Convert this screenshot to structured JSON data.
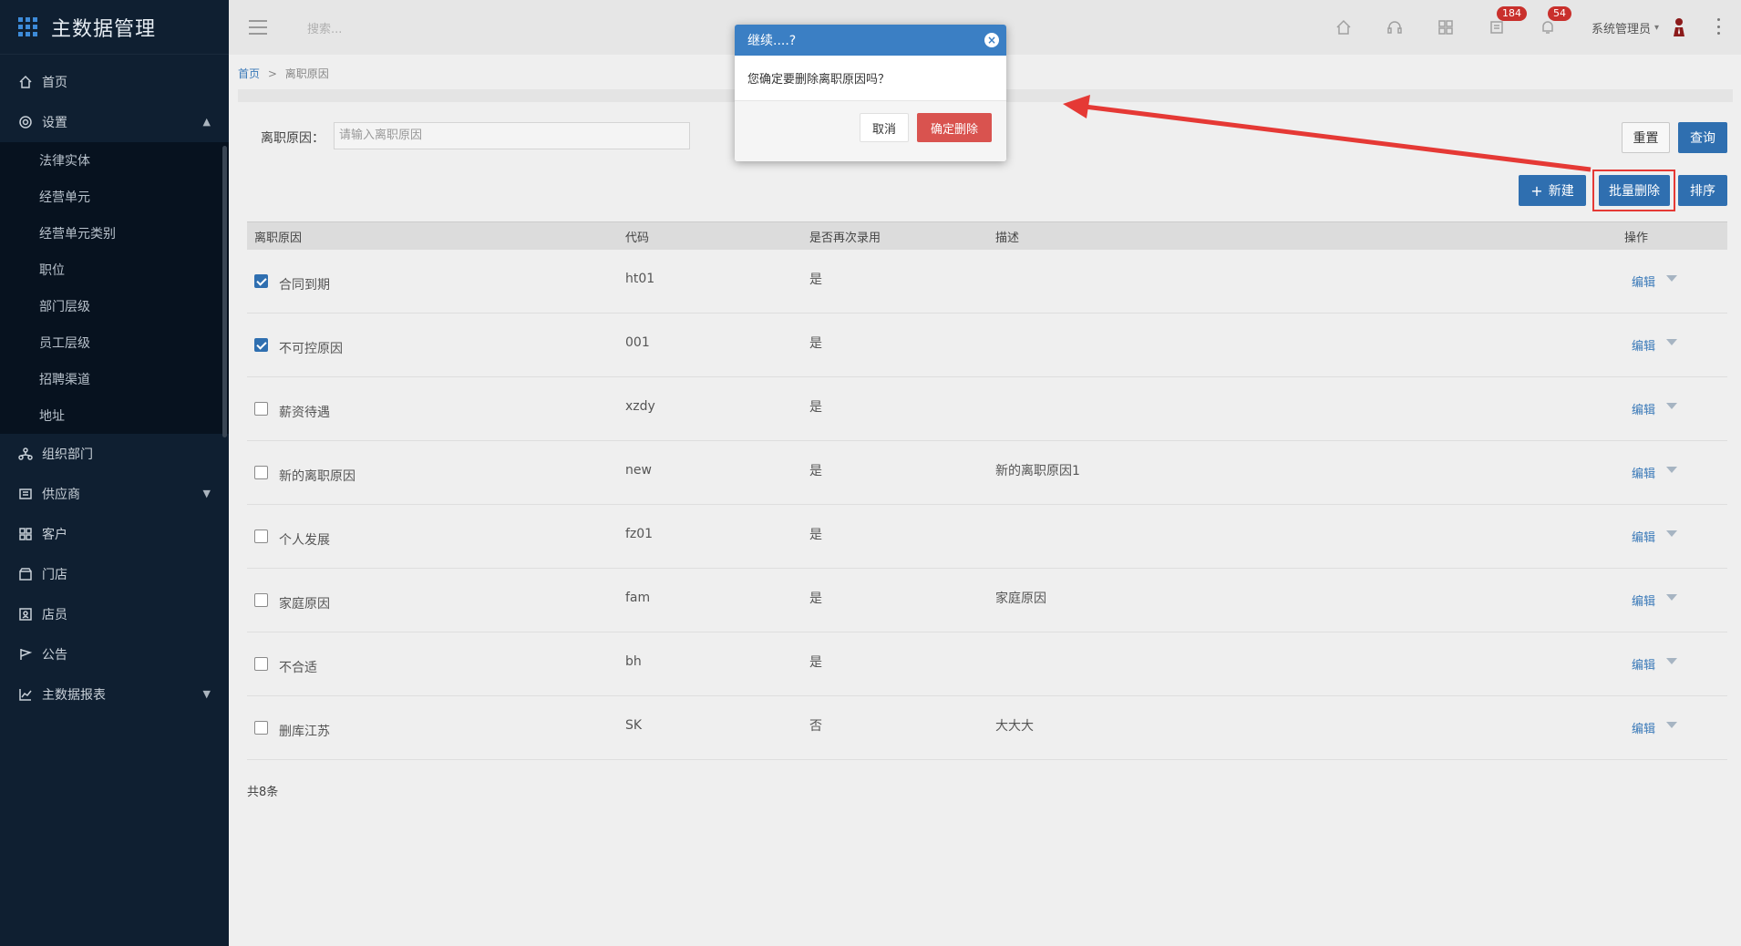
{
  "app": {
    "title": "主数据管理"
  },
  "header": {
    "search_placeholder": "搜索...",
    "badge_messages": "184",
    "badge_notifications": "54",
    "user_name": "系统管理员"
  },
  "sidebar": {
    "items": [
      {
        "label": "首页",
        "icon": "home-icon"
      },
      {
        "label": "设置",
        "icon": "gear-icon"
      },
      {
        "label": "组织部门",
        "icon": "org-icon"
      },
      {
        "label": "供应商",
        "icon": "supplier-icon"
      },
      {
        "label": "客户",
        "icon": "customer-icon"
      },
      {
        "label": "门店",
        "icon": "store-icon"
      },
      {
        "label": "店员",
        "icon": "staff-icon"
      },
      {
        "label": "公告",
        "icon": "announce-icon"
      },
      {
        "label": "主数据报表",
        "icon": "chart-icon"
      }
    ],
    "settings_sub": [
      "法律实体",
      "经营单元",
      "经营单元类别",
      "职位",
      "部门层级",
      "员工层级",
      "招聘渠道",
      "地址"
    ]
  },
  "breadcrumb": {
    "home": "首页",
    "separator": ">",
    "current": "离职原因"
  },
  "filter": {
    "label": "离职原因：",
    "placeholder": "请输入离职原因",
    "reset": "重置",
    "query": "查询"
  },
  "toolbar": {
    "new": "新建",
    "batch_delete": "批量删除",
    "sort": "排序"
  },
  "table": {
    "headers": [
      "离职原因",
      "代码",
      "是否再次录用",
      "描述",
      "操作"
    ],
    "rows": [
      {
        "reason": "合同到期",
        "code": "ht01",
        "rehire": "是",
        "desc": "",
        "checked": true
      },
      {
        "reason": "不可控原因",
        "code": "001",
        "rehire": "是",
        "desc": "",
        "checked": true
      },
      {
        "reason": "薪资待遇",
        "code": "xzdy",
        "rehire": "是",
        "desc": "",
        "checked": false
      },
      {
        "reason": "新的离职原因",
        "code": "new",
        "rehire": "是",
        "desc": "新的离职原因1",
        "checked": false
      },
      {
        "reason": "个人发展",
        "code": "fz01",
        "rehire": "是",
        "desc": "",
        "checked": false
      },
      {
        "reason": "家庭原因",
        "code": "fam",
        "rehire": "是",
        "desc": "家庭原因",
        "checked": false
      },
      {
        "reason": "不合适",
        "code": "bh",
        "rehire": "是",
        "desc": "",
        "checked": false
      },
      {
        "reason": "删库江苏",
        "code": "SK",
        "rehire": "否",
        "desc": "大大大",
        "checked": false
      }
    ],
    "edit_label": "编辑",
    "total": "共8条"
  },
  "dialog": {
    "title": "继续....?",
    "message": "您确定要删除离职原因吗？",
    "cancel": "取消",
    "confirm": "确定删除"
  },
  "colors": {
    "accent": "#2f6fb0",
    "danger": "#d9534f",
    "sidebar": "#0f1f31",
    "annotation": "#e53935"
  }
}
